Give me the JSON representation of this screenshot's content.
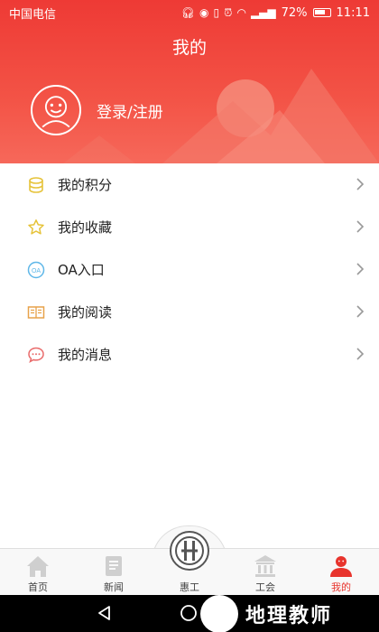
{
  "status_bar": {
    "carrier": "中国电信",
    "battery": "72%",
    "time": "11:11",
    "icons": [
      "headset-icon",
      "location-icon",
      "vibrate-icon",
      "alarm-icon",
      "wifi-icon",
      "signal-icon",
      "battery-icon"
    ]
  },
  "header": {
    "title": "我的",
    "login_label": "登录/注册"
  },
  "menu": {
    "items": [
      {
        "label": "我的积分",
        "icon": "coins-icon",
        "color": "#e6c33a"
      },
      {
        "label": "我的收藏",
        "icon": "star-icon",
        "color": "#e6c33a"
      },
      {
        "label": "OA入口",
        "icon": "oa-icon",
        "color": "#5fb7e8"
      },
      {
        "label": "我的阅读",
        "icon": "book-icon",
        "color": "#e7a24a"
      },
      {
        "label": "我的消息",
        "icon": "message-icon",
        "color": "#e96b6b"
      }
    ]
  },
  "tabbar": {
    "tabs": [
      {
        "label": "首页",
        "icon": "home-icon"
      },
      {
        "label": "新闻",
        "icon": "news-icon"
      },
      {
        "label": "惠工",
        "icon": "union-logo-icon"
      },
      {
        "label": "工会",
        "icon": "building-icon"
      },
      {
        "label": "我的",
        "icon": "person-icon",
        "active": true
      }
    ]
  },
  "watermark": {
    "text": "地理教师"
  },
  "colors": {
    "accent": "#e8342d",
    "header_gradient_top": "#ee3a35",
    "header_gradient_bottom": "#f6685a"
  }
}
